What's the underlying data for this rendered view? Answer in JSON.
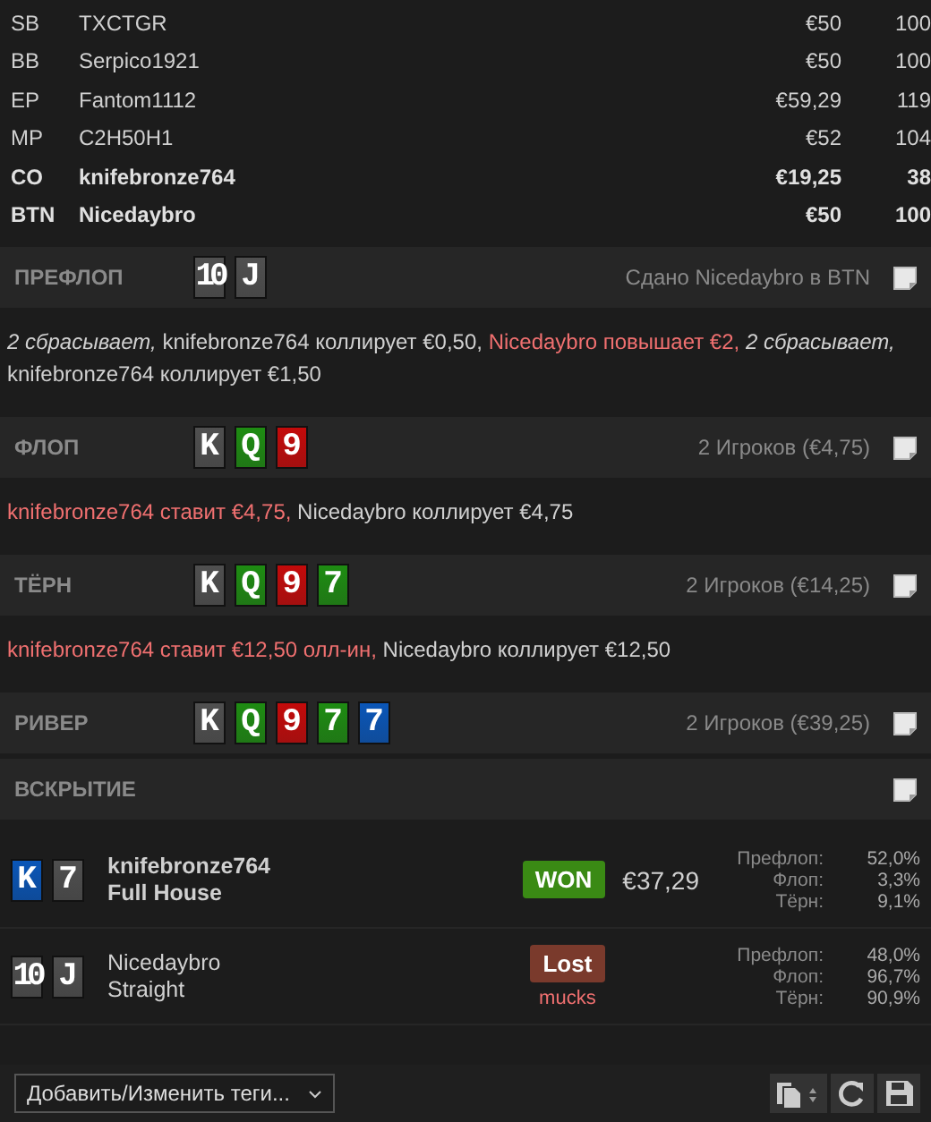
{
  "players": [
    {
      "position": "SB",
      "name": "TXCTGR",
      "stack": "€50",
      "bb": "100",
      "bold": false
    },
    {
      "position": "BB",
      "name": "Serpico1921",
      "stack": "€50",
      "bb": "100",
      "bold": false
    },
    {
      "position": "EP",
      "name": "Fantom1112",
      "stack": "€59,29",
      "bb": "119",
      "bold": false
    },
    {
      "position": "MP",
      "name": "C2H50H1",
      "stack": "€52",
      "bb": "104",
      "bold": false
    },
    {
      "position": "CO",
      "name": "knifebronze764",
      "stack": "€19,25",
      "bb": "38",
      "bold": true
    },
    {
      "position": "BTN",
      "name": "Nicedaybro",
      "stack": "€50",
      "bb": "100",
      "bold": true
    }
  ],
  "streets": [
    {
      "title": "ПРЕФЛОП",
      "cards": [
        {
          "rank": "10",
          "color": "#505050"
        },
        {
          "rank": "J",
          "color": "#505050"
        }
      ],
      "summary": "Сдано Nicedaybro в BTN",
      "actions": [
        {
          "kind": "fold",
          "text": "2 сбрасывает,"
        },
        {
          "kind": "call",
          "text": "knifebronze764 коллирует €0,50,"
        },
        {
          "kind": "raise",
          "text": "Nicedaybro повышает €2,"
        },
        {
          "kind": "fold",
          "text": "2 сбрасывает,"
        },
        {
          "kind": "call",
          "text": "knifebronze764 коллирует €1,50"
        }
      ]
    },
    {
      "title": "ФЛОП",
      "cards": [
        {
          "rank": "K",
          "color": "#505050"
        },
        {
          "rank": "Q",
          "color": "#1e8c12"
        },
        {
          "rank": "9",
          "color": "#c40a0a"
        }
      ],
      "summary": "2 Игроков (€4,75)",
      "actions": [
        {
          "kind": "raise",
          "text": "knifebronze764 ставит €4,75,"
        },
        {
          "kind": "call",
          "text": "Nicedaybro коллирует €4,75"
        }
      ]
    },
    {
      "title": "ТЁРН",
      "cards": [
        {
          "rank": "K",
          "color": "#505050"
        },
        {
          "rank": "Q",
          "color": "#1e8c12"
        },
        {
          "rank": "9",
          "color": "#c40a0a"
        },
        {
          "rank": "7",
          "color": "#1e8c12"
        }
      ],
      "summary": "2 Игроков (€14,25)",
      "actions": [
        {
          "kind": "raise",
          "text": "knifebronze764 ставит €12,50 олл-ин,"
        },
        {
          "kind": "call",
          "text": "Nicedaybro коллирует €12,50"
        }
      ]
    },
    {
      "title": "РИВЕР",
      "cards": [
        {
          "rank": "K",
          "color": "#505050"
        },
        {
          "rank": "Q",
          "color": "#1e8c12"
        },
        {
          "rank": "9",
          "color": "#c40a0a"
        },
        {
          "rank": "7",
          "color": "#1e8c12"
        },
        {
          "rank": "7",
          "color": "#0a56b8"
        }
      ],
      "summary": "2 Игроков (€39,25)"
    },
    {
      "title": "ВСКРЫТИЕ"
    }
  ],
  "showdown": [
    {
      "cards": [
        {
          "rank": "K",
          "color": "#0a56b8"
        },
        {
          "rank": "7",
          "color": "#505050"
        }
      ],
      "name": "knifebronze764",
      "hand": "Full House",
      "bold": true,
      "result": {
        "kind": "won",
        "label": "WON"
      },
      "amount": "€37,29",
      "equity": [
        {
          "label": "Префлоп:",
          "value": "52,0%"
        },
        {
          "label": "Флоп:",
          "value": "3,3%"
        },
        {
          "label": "Тёрн:",
          "value": "9,1%"
        }
      ]
    },
    {
      "cards": [
        {
          "rank": "10",
          "color": "#505050"
        },
        {
          "rank": "J",
          "color": "#505050"
        }
      ],
      "name": "Nicedaybro",
      "hand": "Straight",
      "bold": false,
      "result": {
        "kind": "lost",
        "label": "Lost"
      },
      "note": "mucks",
      "equity": [
        {
          "label": "Префлоп:",
          "value": "48,0%"
        },
        {
          "label": "Флоп:",
          "value": "96,7%"
        },
        {
          "label": "Тёрн:",
          "value": "90,9%"
        }
      ]
    }
  ],
  "footer": {
    "tags_select": "Добавить/Изменить теги..."
  }
}
